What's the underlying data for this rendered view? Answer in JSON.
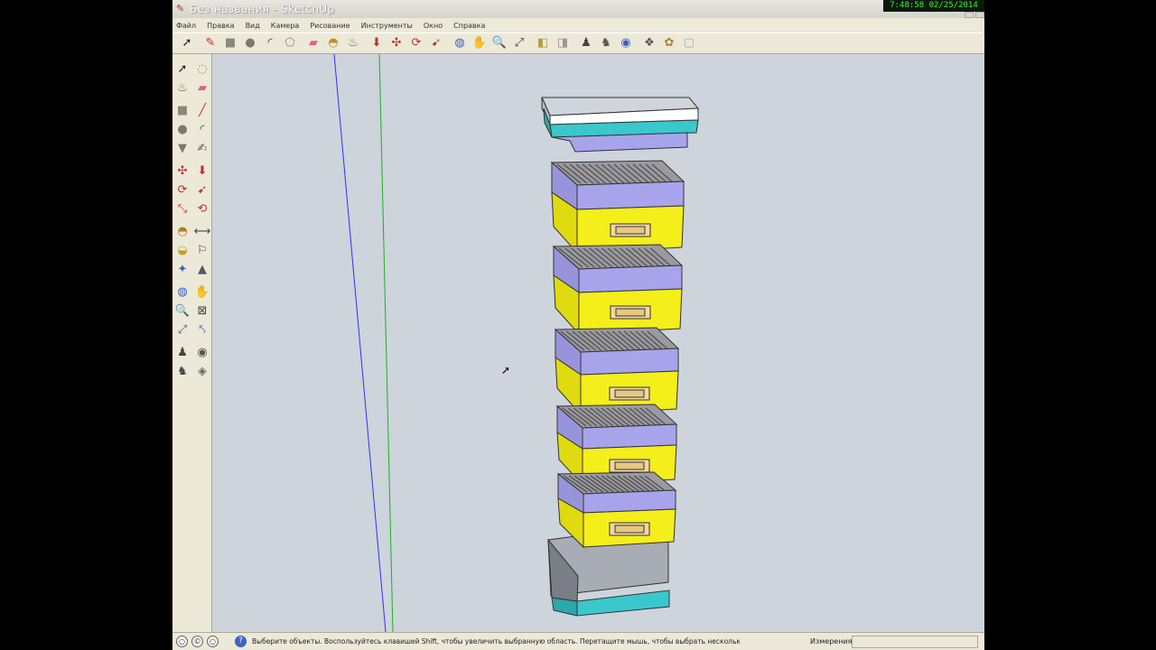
{
  "window": {
    "title": "Без названия - SketchUp",
    "app_icon": "pencil-icon"
  },
  "clock": {
    "text": "7:48:58 02/25/2014"
  },
  "menu": {
    "items": [
      {
        "label": "Файл"
      },
      {
        "label": "Правка"
      },
      {
        "label": "Вид"
      },
      {
        "label": "Камера"
      },
      {
        "label": "Рисование"
      },
      {
        "label": "Инструменты"
      },
      {
        "label": "Окно"
      },
      {
        "label": "Справка"
      }
    ]
  },
  "toolbar": {
    "buttons": [
      {
        "icon": "select-arrow-icon",
        "glyph": "➚",
        "color": "#222"
      },
      {
        "icon": "pencil-icon",
        "glyph": "✎",
        "color": "#c0302a"
      },
      {
        "icon": "rectangle-icon",
        "glyph": "■",
        "color": "#8a8a7a"
      },
      {
        "icon": "circle-icon",
        "glyph": "●",
        "color": "#7a7a70"
      },
      {
        "icon": "arc-icon",
        "glyph": "◜",
        "color": "#333"
      },
      {
        "icon": "polygon-icon",
        "glyph": "⬠",
        "color": "#888"
      },
      {
        "icon": "eraser-icon",
        "glyph": "▰",
        "color": "#e06080"
      },
      {
        "icon": "tape-measure-icon",
        "glyph": "◓",
        "color": "#c09020"
      },
      {
        "icon": "paint-bucket-icon",
        "glyph": "♨",
        "color": "#9a6a2a"
      },
      {
        "icon": "push-pull-icon",
        "glyph": "⬇",
        "color": "#c0302a"
      },
      {
        "icon": "move-icon",
        "glyph": "✣",
        "color": "#c0302a"
      },
      {
        "icon": "rotate-icon",
        "glyph": "⟳",
        "color": "#c0302a"
      },
      {
        "icon": "follow-me-icon",
        "glyph": "➹",
        "color": "#c0302a"
      },
      {
        "icon": "orbit-icon",
        "glyph": "◍",
        "color": "#3a60c0"
      },
      {
        "icon": "pan-icon",
        "glyph": "✋",
        "color": "#666"
      },
      {
        "icon": "zoom-icon",
        "glyph": "🔍",
        "color": "#444"
      },
      {
        "icon": "zoom-extents-icon",
        "glyph": "⤢",
        "color": "#444"
      },
      {
        "icon": "previous-view-icon",
        "glyph": "◧",
        "color": "#b0a040"
      },
      {
        "icon": "next-view-icon",
        "glyph": "◨",
        "color": "#999"
      },
      {
        "icon": "position-camera-icon",
        "glyph": "♟",
        "color": "#444"
      },
      {
        "icon": "walk-icon",
        "glyph": "♞",
        "color": "#555"
      },
      {
        "icon": "look-around-icon",
        "glyph": "◉",
        "color": "#3a60c0"
      },
      {
        "icon": "components-icon",
        "glyph": "❖",
        "color": "#555"
      },
      {
        "icon": "materials-icon",
        "glyph": "✿",
        "color": "#b08030"
      },
      {
        "icon": "styles-icon",
        "glyph": "▢",
        "color": "#aaa"
      }
    ]
  },
  "lefttools": {
    "buttons": [
      {
        "icon": "select-icon",
        "glyph": "➚",
        "color": "#222"
      },
      {
        "icon": "make-component-icon",
        "glyph": "◌",
        "color": "#888"
      },
      {
        "icon": "paint-bucket-icon",
        "glyph": "♨",
        "color": "#8a6a20"
      },
      {
        "icon": "eraser-icon",
        "glyph": "▰",
        "color": "#e06080"
      },
      {
        "icon": "rectangle-icon",
        "glyph": "■",
        "color": "#8a8a7a"
      },
      {
        "icon": "line-icon",
        "glyph": "╱",
        "color": "#c0302a"
      },
      {
        "icon": "circle-icon",
        "glyph": "●",
        "color": "#7a7a70"
      },
      {
        "icon": "arc-icon",
        "glyph": "◜",
        "color": "#333"
      },
      {
        "icon": "polygon-icon",
        "glyph": "▼",
        "color": "#7a7a70"
      },
      {
        "icon": "freehand-icon",
        "glyph": "✍",
        "color": "#555"
      },
      {
        "icon": "move-icon",
        "glyph": "✣",
        "color": "#c0302a"
      },
      {
        "icon": "push-pull-icon",
        "glyph": "⬇",
        "color": "#c0302a"
      },
      {
        "icon": "rotate-icon",
        "glyph": "⟳",
        "color": "#c0302a"
      },
      {
        "icon": "follow-me-icon",
        "glyph": "➹",
        "color": "#c0302a"
      },
      {
        "icon": "scale-icon",
        "glyph": "⤡",
        "color": "#c0302a"
      },
      {
        "icon": "offset-icon",
        "glyph": "⟲",
        "color": "#c0302a"
      },
      {
        "icon": "tape-measure-icon",
        "glyph": "◓",
        "color": "#b08020"
      },
      {
        "icon": "dimension-icon",
        "glyph": "⟷",
        "color": "#444"
      },
      {
        "icon": "protractor-icon",
        "glyph": "◒",
        "color": "#c0a020"
      },
      {
        "icon": "text-icon",
        "glyph": "⚐",
        "color": "#444"
      },
      {
        "icon": "axes-icon",
        "glyph": "✦",
        "color": "#3a60c0"
      },
      {
        "icon": "3d-text-icon",
        "glyph": "▲",
        "color": "#556"
      },
      {
        "icon": "orbit-icon",
        "glyph": "◍",
        "color": "#3a60c0"
      },
      {
        "icon": "pan-icon",
        "glyph": "✋",
        "color": "#666"
      },
      {
        "icon": "zoom-icon",
        "glyph": "🔍",
        "color": "#444"
      },
      {
        "icon": "zoom-window-icon",
        "glyph": "⊠",
        "color": "#444"
      },
      {
        "icon": "zoom-extents-icon",
        "glyph": "⤢",
        "color": "#3a60c0"
      },
      {
        "icon": "previous-icon",
        "glyph": "⤣",
        "color": "#3a60c0"
      },
      {
        "icon": "position-camera-icon",
        "glyph": "♟",
        "color": "#444"
      },
      {
        "icon": "look-around-icon",
        "glyph": "◉",
        "color": "#555"
      },
      {
        "icon": "walk-icon",
        "glyph": "♞",
        "color": "#444"
      },
      {
        "icon": "section-plane-icon",
        "glyph": "◈",
        "color": "#666"
      }
    ]
  },
  "status": {
    "hint": "Выберите объекты. Воспользуйтесь клавишей Shift, чтобы увеличить выбранную область. Перетащите мышь, чтобы выбрать нескольк",
    "measure_label": "Измерения"
  },
  "colors": {
    "viewport_bg": "#cdd4dc",
    "super_purple": "#a8a4ec",
    "super_yellow": "#f4ee1a",
    "frames_gray": "#9a9aa0",
    "lid_cyan": "#3ac8cc",
    "axis_blue": "#3030ff",
    "axis_green": "#20b020"
  }
}
